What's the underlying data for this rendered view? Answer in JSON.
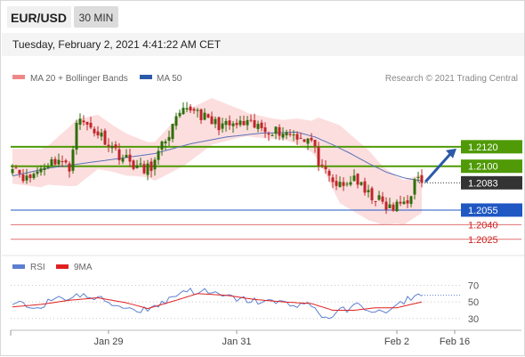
{
  "header": {
    "pair": "EUR/USD",
    "timeframe": "30 MIN",
    "datetime": "Tuesday, February 2, 2021 4:41:22 AM CET"
  },
  "legend": {
    "main": [
      {
        "label": "MA 20 + Bollinger Bands",
        "color": "#ee8888"
      },
      {
        "label": "MA 50",
        "color": "#2b5aa8"
      }
    ],
    "indicator": [
      {
        "label": "RSI",
        "color": "#5b7fd0"
      },
      {
        "label": "9MA",
        "color": "#e02020"
      }
    ],
    "credit": "Research © 2021 Trading Central"
  },
  "colors": {
    "bull": "#2f6e0a",
    "bear": "#c0252a",
    "resistance": "#4f9a06",
    "support": "#1f57c3",
    "minor_support": "#e07070",
    "arrow": "#2b5aa8",
    "bollinger_fill": "#fbd8d8"
  },
  "chart_data": [
    {
      "type": "candlestick",
      "x_ticks": [
        "Jan 29",
        "Jan 31",
        "Feb 2",
        "Feb 16"
      ],
      "y_range": [
        1.2012,
        1.2182
      ],
      "current_price": 1.2083,
      "levels": [
        {
          "value": 1.212,
          "label": "1.2120",
          "kind": "resistance"
        },
        {
          "value": 1.21,
          "label": "1.2100",
          "kind": "resistance"
        },
        {
          "value": 1.2083,
          "label": "1.2083",
          "kind": "price"
        },
        {
          "value": 1.2055,
          "label": "1.2055",
          "kind": "support"
        },
        {
          "value": 1.204,
          "label": "1.2040",
          "kind": "minor_support"
        },
        {
          "value": 1.2025,
          "label": "1.2025",
          "kind": "minor_support"
        }
      ],
      "close_path": [
        [
          0,
          1.2103
        ],
        [
          4,
          1.2086
        ],
        [
          9,
          1.2101
        ],
        [
          13,
          1.2108
        ],
        [
          16,
          1.2096
        ],
        [
          18,
          1.2148
        ],
        [
          22,
          1.214
        ],
        [
          26,
          1.2128
        ],
        [
          30,
          1.2112
        ],
        [
          34,
          1.2102
        ],
        [
          37,
          1.2095
        ],
        [
          40,
          1.2104
        ],
        [
          43,
          1.2128
        ],
        [
          47,
          1.2152
        ],
        [
          51,
          1.216
        ],
        [
          55,
          1.2146
        ],
        [
          60,
          1.2141
        ],
        [
          65,
          1.2143
        ],
        [
          70,
          1.2139
        ],
        [
          75,
          1.2136
        ],
        [
          80,
          1.2132
        ],
        [
          84,
          1.2126
        ],
        [
          87,
          1.2095
        ],
        [
          90,
          1.2083
        ],
        [
          93,
          1.2078
        ],
        [
          96,
          1.209
        ],
        [
          99,
          1.2072
        ],
        [
          102,
          1.2068
        ],
        [
          105,
          1.2058
        ],
        [
          107,
          1.2056
        ],
        [
          109,
          1.2062
        ],
        [
          111,
          1.2065
        ],
        [
          113,
          1.2083
        ],
        [
          115,
          1.2086
        ]
      ],
      "ma50_path": [
        [
          0,
          1.209
        ],
        [
          10,
          1.2098
        ],
        [
          20,
          1.2103
        ],
        [
          30,
          1.2108
        ],
        [
          40,
          1.2113
        ],
        [
          50,
          1.2123
        ],
        [
          60,
          1.213
        ],
        [
          70,
          1.2134
        ],
        [
          80,
          1.2135
        ],
        [
          85,
          1.213
        ],
        [
          90,
          1.2122
        ],
        [
          95,
          1.2113
        ],
        [
          100,
          1.2103
        ],
        [
          105,
          1.2094
        ],
        [
          110,
          1.2088
        ],
        [
          115,
          1.2085
        ]
      ],
      "ma20_path": [
        [
          0,
          1.21
        ],
        [
          8,
          1.2098
        ],
        [
          16,
          1.211
        ],
        [
          24,
          1.2125
        ],
        [
          32,
          1.2112
        ],
        [
          40,
          1.2105
        ],
        [
          48,
          1.2128
        ],
        [
          56,
          1.2146
        ],
        [
          64,
          1.2144
        ],
        [
          72,
          1.2139
        ],
        [
          80,
          1.2136
        ],
        [
          86,
          1.2128
        ],
        [
          92,
          1.2102
        ],
        [
          98,
          1.2086
        ],
        [
          104,
          1.207
        ],
        [
          110,
          1.2063
        ],
        [
          115,
          1.2072
        ]
      ],
      "bollinger_width_path": [
        [
          0,
          0.0018
        ],
        [
          10,
          0.002
        ],
        [
          18,
          0.0034
        ],
        [
          28,
          0.0024
        ],
        [
          38,
          0.0018
        ],
        [
          48,
          0.0028
        ],
        [
          56,
          0.0024
        ],
        [
          66,
          0.0012
        ],
        [
          76,
          0.001
        ],
        [
          84,
          0.0016
        ],
        [
          92,
          0.004
        ],
        [
          100,
          0.0036
        ],
        [
          108,
          0.0024
        ],
        [
          115,
          0.002
        ]
      ],
      "projection": {
        "to_value": 1.212
      }
    },
    {
      "type": "line",
      "y_ticks": [
        70,
        50,
        30
      ],
      "y_range": [
        18,
        78
      ],
      "rsi_path": [
        [
          0,
          48
        ],
        [
          6,
          44
        ],
        [
          12,
          52
        ],
        [
          18,
          58
        ],
        [
          24,
          54
        ],
        [
          30,
          45
        ],
        [
          36,
          40
        ],
        [
          42,
          48
        ],
        [
          48,
          64
        ],
        [
          54,
          62
        ],
        [
          60,
          56
        ],
        [
          66,
          52
        ],
        [
          72,
          50
        ],
        [
          78,
          48
        ],
        [
          84,
          46
        ],
        [
          88,
          30
        ],
        [
          92,
          38
        ],
        [
          96,
          46
        ],
        [
          100,
          42
        ],
        [
          104,
          36
        ],
        [
          108,
          44
        ],
        [
          112,
          56
        ],
        [
          115,
          58
        ]
      ],
      "ma9_path": [
        [
          0,
          44
        ],
        [
          8,
          47
        ],
        [
          16,
          52
        ],
        [
          24,
          55
        ],
        [
          32,
          49
        ],
        [
          38,
          42
        ],
        [
          46,
          52
        ],
        [
          52,
          60
        ],
        [
          60,
          58
        ],
        [
          68,
          53
        ],
        [
          76,
          50
        ],
        [
          84,
          48
        ],
        [
          90,
          40
        ],
        [
          96,
          40
        ],
        [
          102,
          43
        ],
        [
          108,
          43
        ],
        [
          115,
          50
        ]
      ],
      "rsi_last": 58
    }
  ]
}
